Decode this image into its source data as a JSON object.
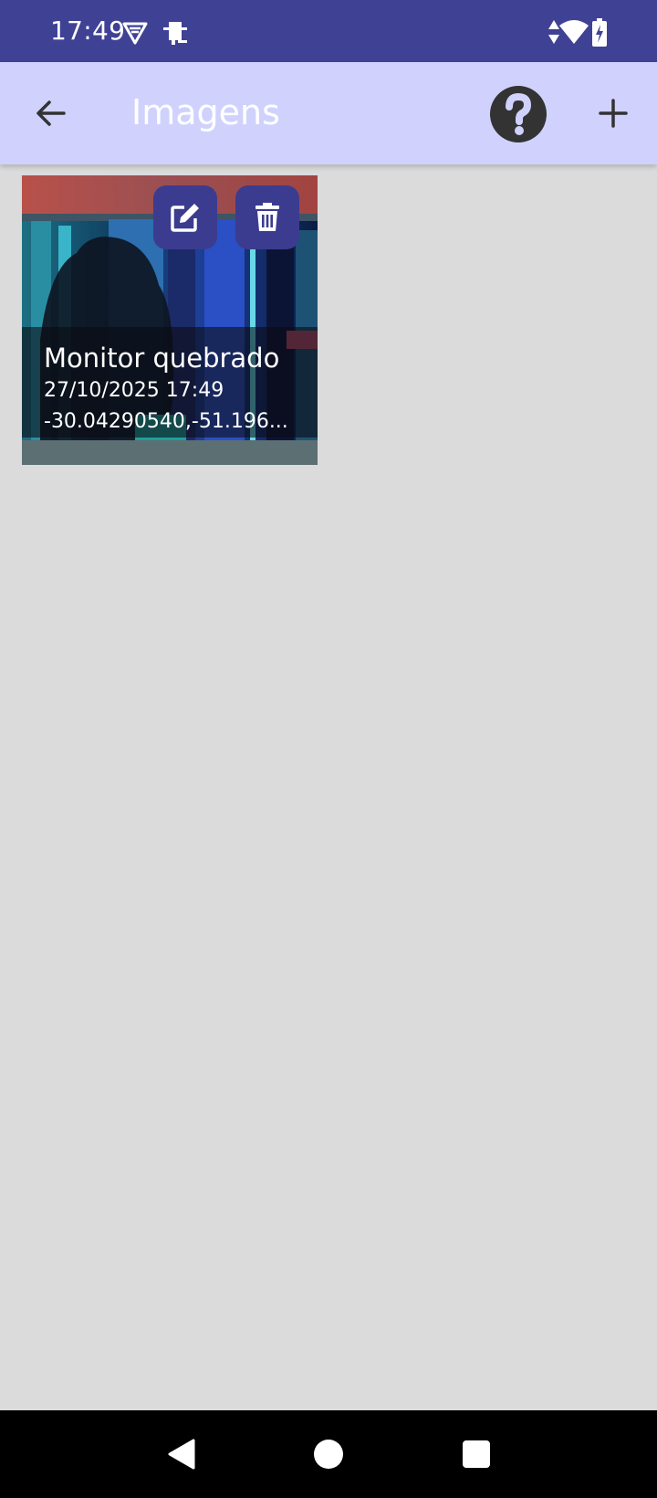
{
  "status_bar": {
    "time": "17:49",
    "icons": [
      "vpn-shield-icon",
      "nfc-payment-icon",
      "data-arrows-icon",
      "wifi-icon",
      "battery-charging-icon"
    ]
  },
  "app_bar": {
    "title": "Imagens",
    "back_icon": "arrow-back-icon",
    "help_icon": "help-circle-icon",
    "add_icon": "plus-icon"
  },
  "images": [
    {
      "title": "Monitor quebrado",
      "date": "27/10/2025 17:49",
      "coordinates": "-30.04290540,-51.196...",
      "edit_icon": "edit-icon",
      "delete_icon": "trash-icon"
    }
  ],
  "nav_bar": {
    "icons": [
      "nav-back-icon",
      "nav-home-icon",
      "nav-recents-icon"
    ]
  },
  "colors": {
    "status_bar": "#3f4294",
    "app_bar": "#d0d2fd",
    "background": "#dcdbdc",
    "action_button": "#3b3c8f",
    "nav_bar": "#000000"
  }
}
